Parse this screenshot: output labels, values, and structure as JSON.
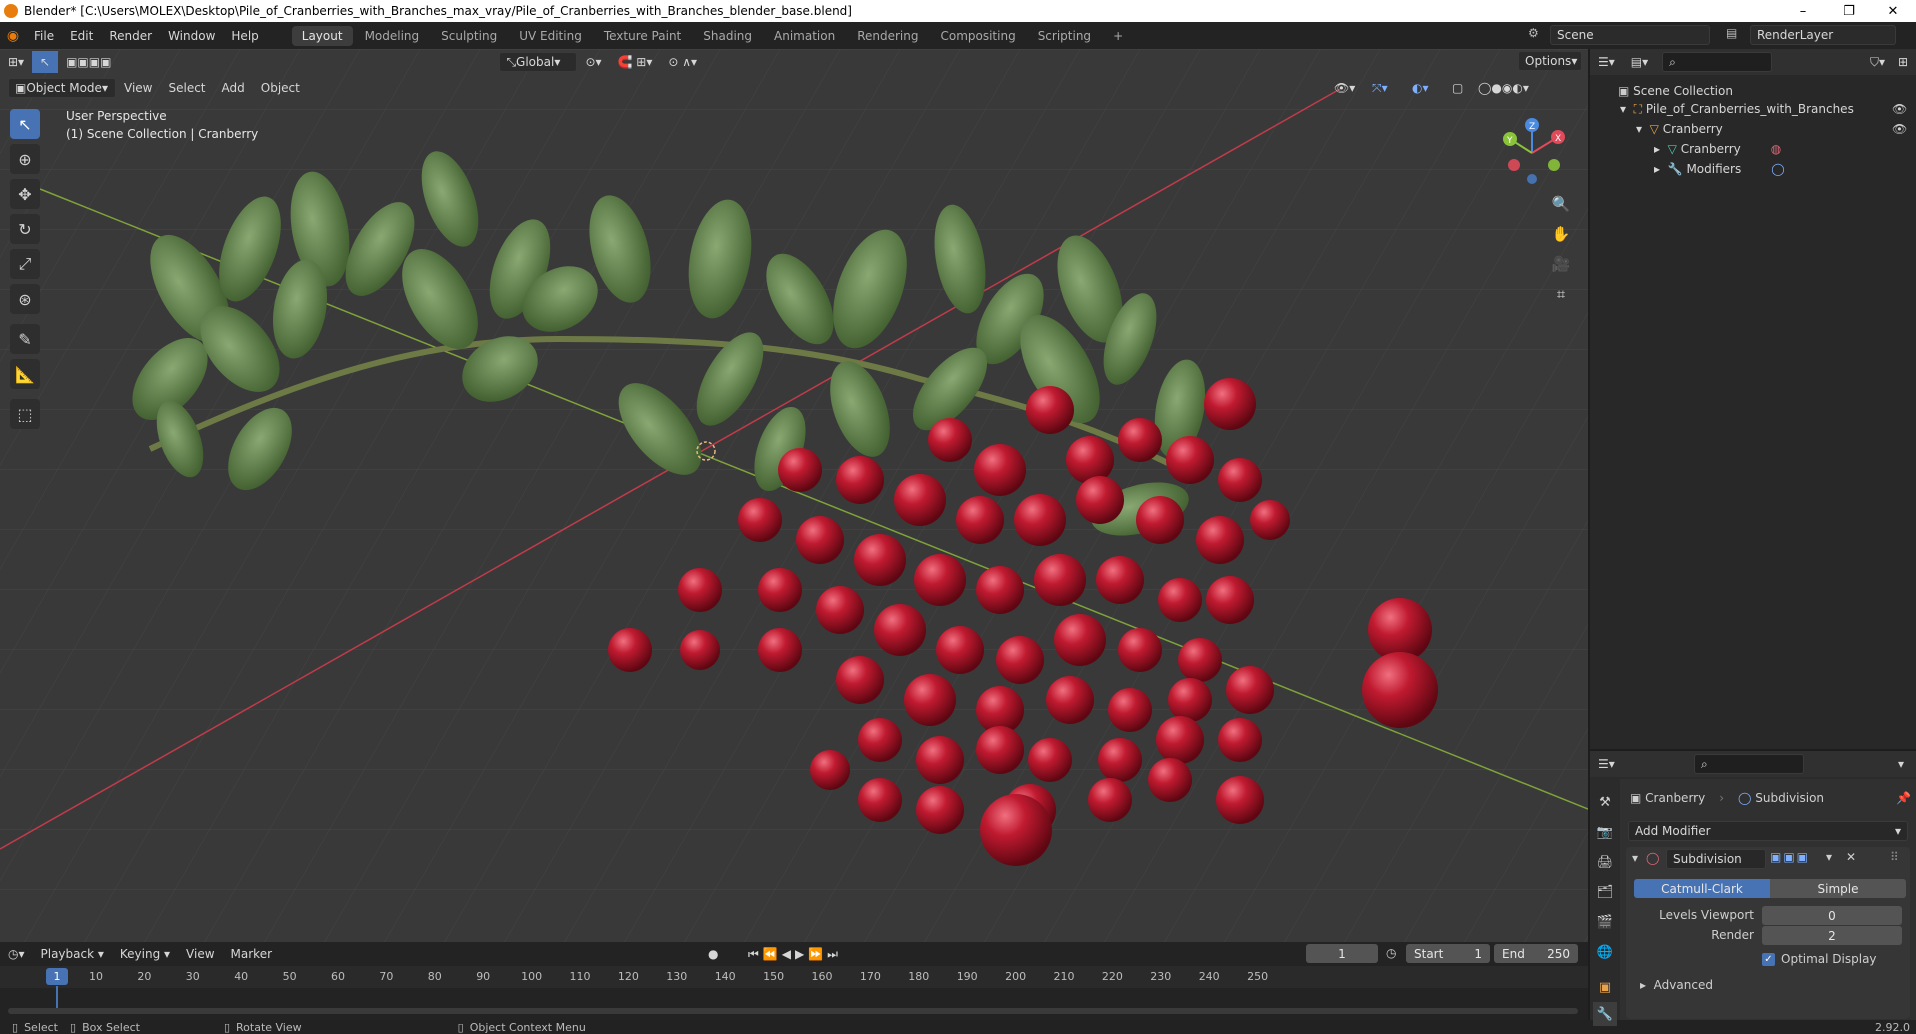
{
  "window": {
    "title": "Blender* [C:\\Users\\MOLEX\\Desktop\\Pile_of_Cranberries_with_Branches_max_vray/Pile_of_Cranberries_with_Branches_blender_base.blend]",
    "minimize": "–",
    "maximize": "❐",
    "close": "✕"
  },
  "menu": [
    "File",
    "Edit",
    "Render",
    "Window",
    "Help"
  ],
  "workspaces": [
    "Layout",
    "Modeling",
    "Sculpting",
    "UV Editing",
    "Texture Paint",
    "Shading",
    "Animation",
    "Rendering",
    "Compositing",
    "Scripting"
  ],
  "workspace_add": "+",
  "scene": {
    "name": "Scene",
    "render_layer": "RenderLayer"
  },
  "viewport": {
    "mode": "Object Mode",
    "menus": [
      "View",
      "Select",
      "Add",
      "Object"
    ],
    "transform_orientation": "Global",
    "options": "Options",
    "overlay_title": "User Perspective",
    "overlay_sub": "(1) Scene Collection | Cranberry",
    "gizmo": {
      "x": "X",
      "y": "Y",
      "z": "Z"
    }
  },
  "outliner": {
    "root": "Scene Collection",
    "items": [
      {
        "label": "Pile_of_Cranberries_with_Branches",
        "depth": 1
      },
      {
        "label": "Cranberry",
        "depth": 2
      },
      {
        "label": "Cranberry",
        "depth": 3
      },
      {
        "label": "Modifiers",
        "depth": 3
      }
    ]
  },
  "properties": {
    "object": "Cranberry",
    "modifier_crumb": "Subdivision",
    "add_modifier": "Add Modifier",
    "modifier_name": "Subdivision",
    "type_options": [
      "Catmull-Clark",
      "Simple"
    ],
    "levels_viewport_label": "Levels Viewport",
    "levels_viewport": "0",
    "render_label": "Render",
    "render": "2",
    "optimal_display": "Optimal Display",
    "advanced": "Advanced"
  },
  "timeline": {
    "menus": [
      "Playback",
      "Keying",
      "View",
      "Marker"
    ],
    "current_frame": "1",
    "start_label": "Start",
    "start": "1",
    "end_label": "End",
    "end": "250",
    "ticks": [
      "1",
      "10",
      "20",
      "30",
      "40",
      "50",
      "60",
      "70",
      "80",
      "90",
      "100",
      "110",
      "120",
      "130",
      "140",
      "150",
      "160",
      "170",
      "180",
      "190",
      "200",
      "210",
      "220",
      "230",
      "240",
      "250"
    ]
  },
  "status": {
    "select": "Select",
    "box_select": "Box Select",
    "rotate_view": "Rotate View",
    "context_menu": "Object Context Menu",
    "version": "2.92.0"
  },
  "colors": {
    "accent": "#4772b3",
    "berry": "#b3142a",
    "leaf": "#4c6b35"
  }
}
